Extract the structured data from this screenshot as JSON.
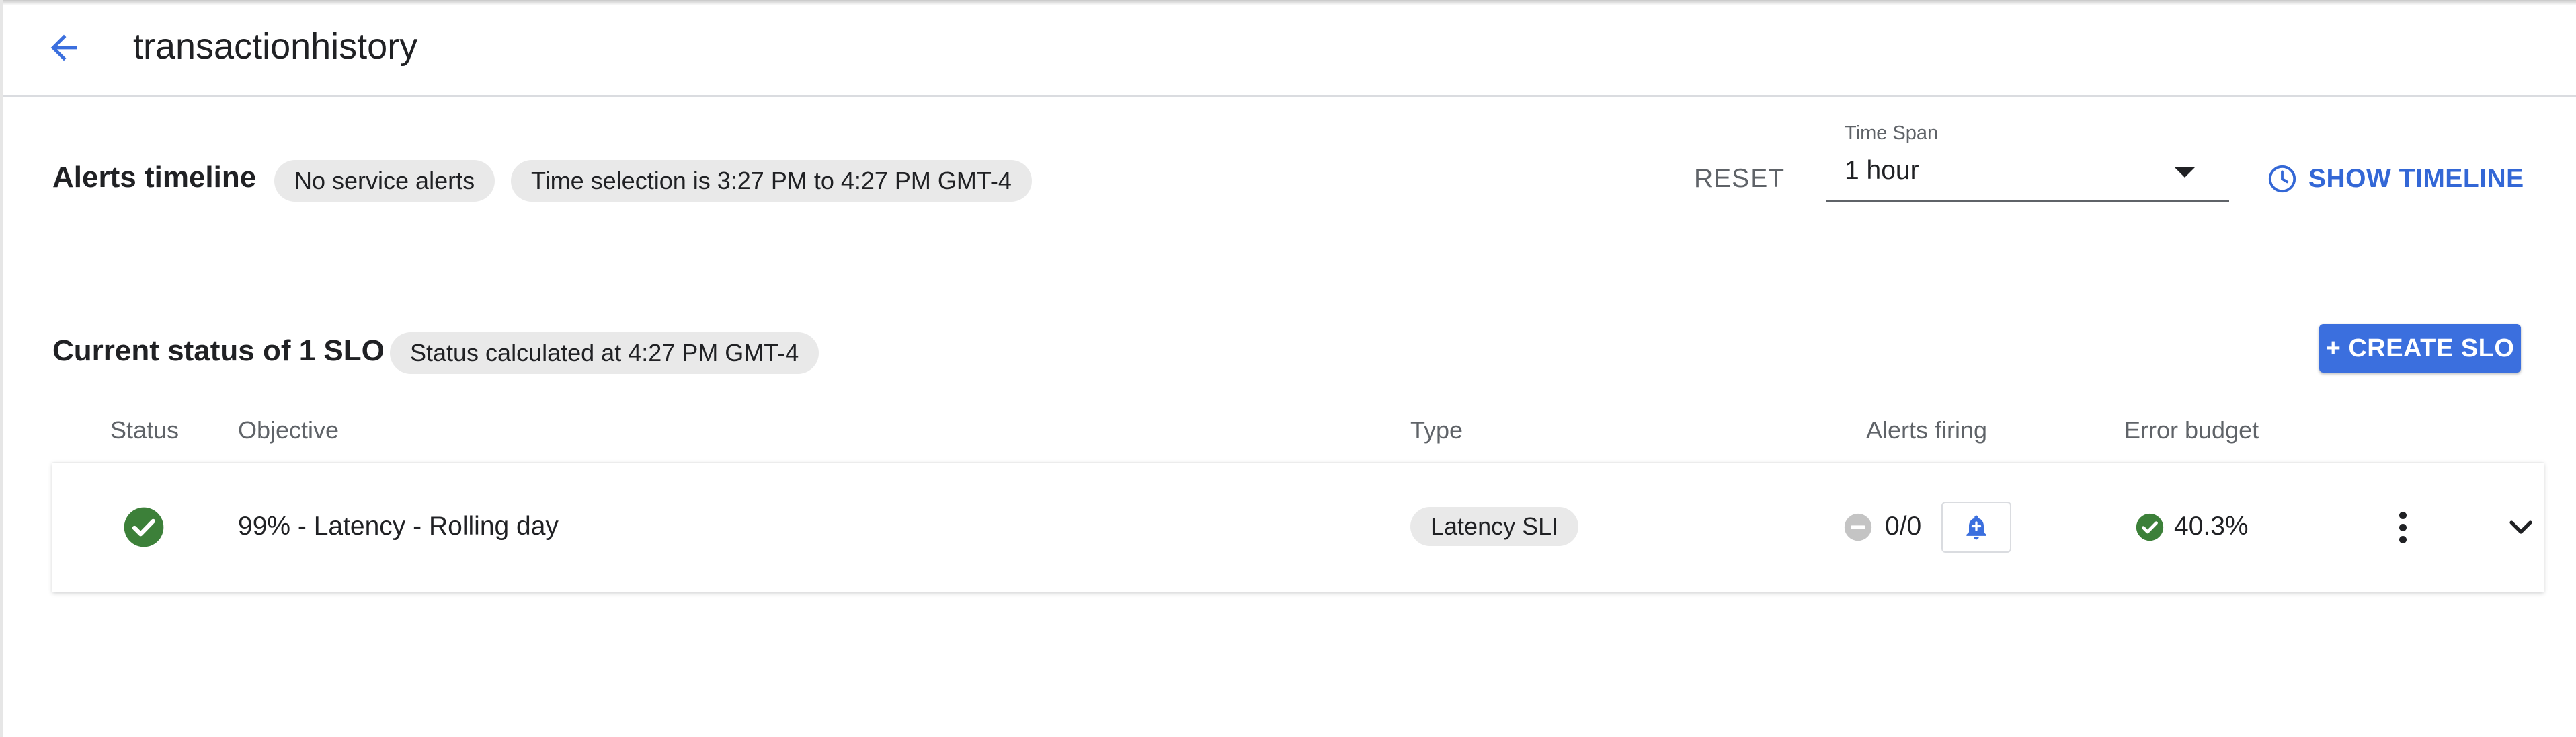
{
  "header": {
    "title": "transactionhistory",
    "back_icon": "arrow-back-icon"
  },
  "alerts_timeline": {
    "title": "Alerts timeline",
    "chips": [
      "No service alerts",
      "Time selection is 3:27 PM to 4:27 PM GMT-4"
    ],
    "reset_label": "RESET",
    "time_span": {
      "label": "Time Span",
      "value": "1 hour"
    },
    "show_timeline_label": "SHOW TIMELINE",
    "show_timeline_icon": "clock-icon"
  },
  "slo_section": {
    "title": "Current status of 1 SLO",
    "status_chip": "Status calculated at 4:27 PM GMT-4",
    "create_button": "+ CREATE SLO",
    "columns": [
      "Status",
      "Objective",
      "Type",
      "Alerts firing",
      "Error budget"
    ],
    "rows": [
      {
        "status": "ok",
        "status_icon": "check-circle-icon",
        "objective": "99% - Latency - Rolling day",
        "type": "Latency SLI",
        "alerts_firing": "0/0",
        "alerts_icon": "minus-circle-icon",
        "add_alert_icon": "bell-add-icon",
        "error_budget": "40.3%",
        "budget_icon": "check-circle-icon"
      }
    ]
  },
  "colors": {
    "accent": "#3b6fde",
    "link": "#3367d6",
    "success": "#3c8039",
    "chip_bg": "#e9e9e9",
    "muted": "#5f6368"
  }
}
